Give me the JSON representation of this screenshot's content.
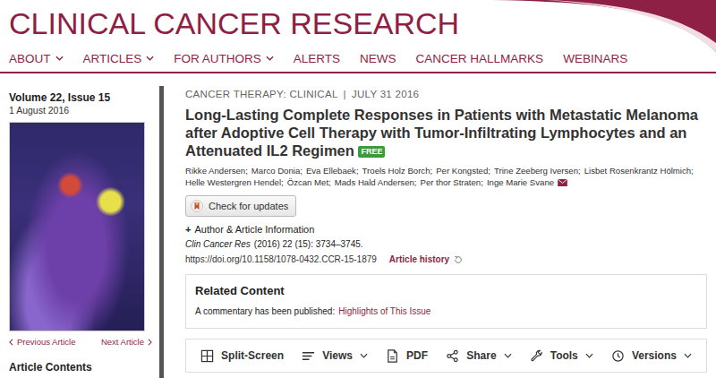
{
  "header": {
    "logo": "CLINICAL CANCER RESEARCH"
  },
  "nav": [
    {
      "label": "ABOUT",
      "dropdown": true
    },
    {
      "label": "ARTICLES",
      "dropdown": true
    },
    {
      "label": "FOR AUTHORS",
      "dropdown": true
    },
    {
      "label": "ALERTS",
      "dropdown": false
    },
    {
      "label": "NEWS",
      "dropdown": false
    },
    {
      "label": "CANCER HALLMARKS",
      "dropdown": false
    },
    {
      "label": "WEBINARS",
      "dropdown": false
    }
  ],
  "sidebar": {
    "issue": "Volume 22, Issue 15",
    "date": "1 August 2016",
    "prev": "Previous Article",
    "next": "Next Article",
    "contents": "Article Contents"
  },
  "article": {
    "section": "CANCER THERAPY: CLINICAL",
    "separator": "|",
    "date": "JULY 31 2016",
    "title": "Long-Lasting Complete Responses in Patients with Metastatic Melanoma after Adoptive Cell Therapy with Tumor-Infiltrating Lymphocytes and an Attenuated IL2 Regimen",
    "badge": "FREE",
    "authors": [
      "Rikke Andersen;",
      "Marco Donia;",
      "Eva Ellebaek;",
      "Troels Holz Borch;",
      "Per Kongsted;",
      "Trine Zeeberg Iversen;",
      "Lisbet Rosenkrantz Hölmich;",
      "Helle Westergren Hendel;",
      "Özcan Met;",
      "Mads Hald Andersen;",
      "Per thor Straten;",
      "Inge Marie Svane"
    ],
    "check_updates": "Check for updates",
    "plus": "+",
    "author_info": "Author & Article Information",
    "journal": "Clin Cancer Res",
    "details": "(2016) 22 (15): 3734–3745.",
    "doi": "https://doi.org/10.1158/1078-0432.CCR-15-1879",
    "history": "Article history"
  },
  "related": {
    "title": "Related Content",
    "text": "A commentary has been published:",
    "link": "Highlights of This Issue"
  },
  "toolbar": [
    {
      "label": "Split-Screen",
      "kind": "split",
      "dropdown": false
    },
    {
      "label": "Views",
      "kind": "views",
      "dropdown": true
    },
    {
      "label": "PDF",
      "kind": "pdf",
      "dropdown": false
    },
    {
      "label": "Share",
      "kind": "share",
      "dropdown": true
    },
    {
      "label": "Tools",
      "kind": "tools",
      "dropdown": true
    },
    {
      "label": "Versions",
      "kind": "versions",
      "dropdown": true
    }
  ]
}
